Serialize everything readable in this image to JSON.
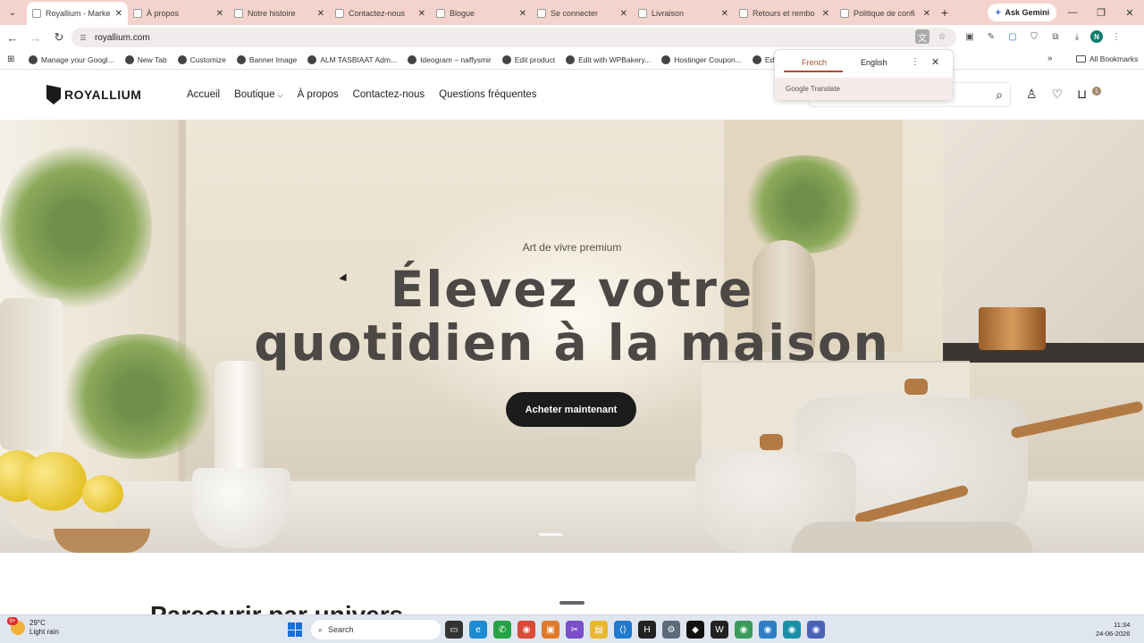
{
  "browser": {
    "tabs": [
      {
        "title": "Royallium - Marke",
        "active": true
      },
      {
        "title": "À propos"
      },
      {
        "title": "Notre histoire"
      },
      {
        "title": "Contactez-nous"
      },
      {
        "title": "Blogue"
      },
      {
        "title": "Se connecter"
      },
      {
        "title": "Livraison"
      },
      {
        "title": "Retours et rembo"
      },
      {
        "title": "Politique de confi"
      }
    ],
    "ask_gemini": "Ask Gemini",
    "url": "royallium.com",
    "profile_initial": "N",
    "bookmarks": [
      "Manage your Googl...",
      "New Tab",
      "Customize",
      "Banner Image",
      "ALM TASBIAAT Adm...",
      "Ideogram – naffysmir",
      "Edit product",
      "Edit with WPBakery...",
      "Hostinger Coupon...",
      "Edit with El"
    ],
    "all_bookmarks": "All Bookmarks"
  },
  "translate": {
    "lang_source": "French",
    "lang_target": "English",
    "footer": "Google Translate"
  },
  "site": {
    "logo": "ROYALLIUM",
    "nav": [
      "Accueil",
      "Boutique",
      "À propos",
      "Contactez-nous",
      "Questions fréquentes"
    ],
    "cart_count": "1"
  },
  "hero": {
    "kicker": "Art de vivre premium",
    "title_line1": "Élevez votre",
    "title_line2": "quotidien à la maison",
    "cta": "Acheter maintenant"
  },
  "section": {
    "title": "Parcourir par univers"
  },
  "taskbar": {
    "temperature": "29°C",
    "condition": "Light rain",
    "weather_badge": "9+",
    "search": "Search",
    "time": "11:34",
    "date": "24-06-2026"
  }
}
